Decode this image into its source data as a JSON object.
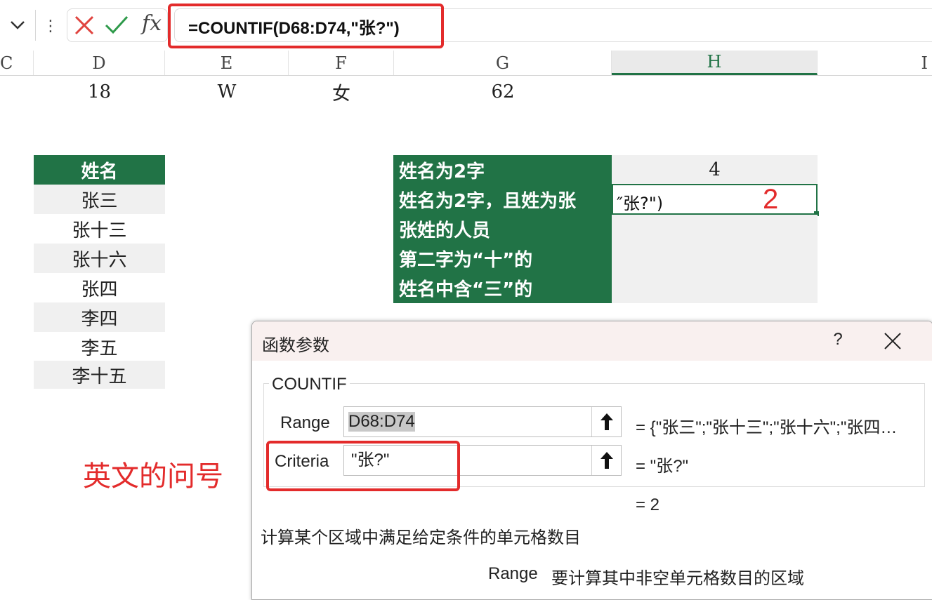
{
  "formula_bar": {
    "dropdown_icon": "chevron-down-icon",
    "more_icon": "vertical-dots-icon",
    "cancel_icon": "x-icon",
    "confirm_icon": "check-icon",
    "fx_label": "fx",
    "formula": "=COUNTIF(D68:D74,\"张?\")"
  },
  "columns": {
    "c": "C",
    "d": "D",
    "e": "E",
    "f": "F",
    "g": "G",
    "h": "H",
    "i": "I"
  },
  "row_top": {
    "d": "18",
    "e": "W",
    "f": "女",
    "g": "62"
  },
  "name_table": {
    "header": "姓名",
    "rows": [
      "张三",
      "张十三",
      "张十六",
      "张四",
      "李四",
      "李五",
      "李十五"
    ]
  },
  "criteria_table": {
    "labels": [
      "姓名为2字",
      "姓名为2字，且姓为张",
      "张姓的人员",
      "第二字为“十”的",
      "姓名中含“三”的"
    ],
    "result_1": "4",
    "editing_text": "″张?\")",
    "result_2_annotation": "2"
  },
  "annotation": "英文的问号",
  "dialog": {
    "title": "函数参数",
    "help": "?",
    "close_icon": "close-icon",
    "function_name": "COUNTIF",
    "range_label": "Range",
    "range_value": "D68:D74",
    "range_eval": "=  {\"张三\";\"张十三\";\"张十六\";\"张四…",
    "criteria_label": "Criteria",
    "criteria_value": "\"张?\"",
    "criteria_eval": "=  \"张?\"",
    "result": "=  2",
    "description": "计算某个区域中满足给定条件的单元格数目",
    "arg_name": "Range",
    "arg_description": "要计算其中非空单元格数目的区域",
    "upload_icon": "collapse-arrow-up-icon"
  },
  "colors": {
    "accent_green": "#217346",
    "highlight_red": "#e32b2b"
  }
}
